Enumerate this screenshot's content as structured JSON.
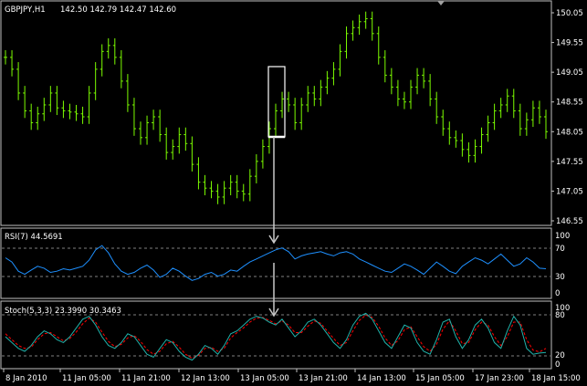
{
  "window": {
    "symbol_label": "GBPJPY,H1",
    "ohlc_label": "142.50 142.79 142.47 142.60"
  },
  "price_panel": {
    "y_ticks": [
      "150.05",
      "149.55",
      "149.05",
      "148.55",
      "148.05",
      "147.55",
      "147.05",
      "146.55"
    ]
  },
  "rsi_panel": {
    "label": "RSI(7) 44.5691",
    "y_ticks": [
      "100",
      "70",
      "30",
      "0"
    ]
  },
  "stoch_panel": {
    "label": "Stoch(5,3,3) 23.3990 30.3463",
    "y_ticks": [
      "100",
      "80",
      "20",
      "0"
    ]
  },
  "time_axis": {
    "labels": [
      "8 Jan 2010",
      "11 Jan 05:00",
      "11 Jan 21:00",
      "12 Jan 13:00",
      "13 Jan 05:00",
      "13 Jan 21:00",
      "14 Jan 13:00",
      "15 Jan 05:00",
      "17 Jan 23:00",
      "18 Jan 15:00"
    ]
  },
  "colors": {
    "background": "#000000",
    "candle": "#7CFC00",
    "grid_border": "#C0C0C0",
    "rsi_line": "#1E90FF",
    "stoch_main": "#20B2AA",
    "stoch_signal": "#FF0000",
    "level_line": "#808080",
    "annotation": "#FFFFFF"
  },
  "chart_data": {
    "type": "line",
    "price_closes": [
      149.3,
      149.1,
      148.7,
      148.4,
      148.2,
      148.35,
      148.5,
      148.7,
      148.45,
      148.4,
      148.38,
      148.35,
      148.3,
      148.7,
      149.1,
      149.4,
      149.5,
      149.3,
      148.9,
      148.5,
      148.1,
      147.95,
      148.2,
      148.3,
      148.0,
      147.7,
      147.8,
      148.0,
      147.85,
      147.5,
      147.2,
      147.1,
      147.05,
      146.95,
      147.1,
      147.2,
      147.05,
      147.0,
      147.3,
      147.55,
      147.8,
      148.1,
      148.4,
      148.6,
      148.5,
      148.2,
      148.5,
      148.7,
      148.6,
      148.8,
      148.95,
      149.1,
      149.4,
      149.7,
      149.8,
      149.9,
      149.95,
      149.7,
      149.3,
      149.0,
      148.8,
      148.6,
      148.55,
      148.8,
      149.0,
      148.9,
      148.6,
      148.3,
      148.1,
      147.95,
      147.9,
      147.75,
      147.65,
      147.8,
      148.0,
      148.2,
      148.4,
      148.5,
      148.65,
      148.4,
      148.1,
      148.25,
      148.45,
      148.3,
      148.05
    ],
    "rsi_values": [
      62,
      55,
      40,
      35,
      42,
      48,
      45,
      38,
      40,
      44,
      42,
      45,
      48,
      58,
      75,
      82,
      70,
      52,
      40,
      35,
      38,
      45,
      50,
      42,
      30,
      35,
      45,
      40,
      32,
      25,
      28,
      35,
      38,
      32,
      35,
      42,
      40,
      48,
      55,
      60,
      65,
      70,
      75,
      78,
      72,
      60,
      65,
      68,
      70,
      72,
      68,
      65,
      70,
      72,
      68,
      60,
      55,
      50,
      45,
      40,
      38,
      45,
      52,
      48,
      42,
      35,
      45,
      55,
      48,
      40,
      36,
      48,
      55,
      62,
      58,
      52,
      60,
      68,
      58,
      48,
      52,
      62,
      55,
      45,
      44
    ],
    "stoch_main": [
      50,
      40,
      30,
      25,
      35,
      50,
      60,
      55,
      45,
      40,
      50,
      65,
      80,
      85,
      70,
      50,
      35,
      30,
      40,
      55,
      50,
      35,
      20,
      15,
      30,
      45,
      40,
      25,
      15,
      10,
      20,
      35,
      30,
      20,
      35,
      55,
      60,
      70,
      80,
      85,
      82,
      75,
      70,
      80,
      65,
      50,
      60,
      75,
      80,
      70,
      55,
      40,
      30,
      45,
      70,
      85,
      90,
      80,
      60,
      40,
      30,
      50,
      70,
      65,
      40,
      25,
      20,
      45,
      75,
      80,
      50,
      30,
      45,
      70,
      80,
      65,
      40,
      30,
      60,
      85,
      70,
      30,
      20,
      22,
      23
    ],
    "stoch_signal": [
      55,
      45,
      35,
      30,
      32,
      45,
      55,
      57,
      50,
      43,
      47,
      58,
      72,
      82,
      75,
      58,
      42,
      33,
      37,
      48,
      52,
      42,
      28,
      20,
      25,
      38,
      42,
      32,
      20,
      13,
      18,
      30,
      32,
      25,
      30,
      48,
      57,
      65,
      75,
      82,
      83,
      78,
      72,
      77,
      70,
      57,
      57,
      68,
      77,
      73,
      60,
      47,
      35,
      40,
      60,
      78,
      87,
      83,
      68,
      48,
      35,
      43,
      62,
      67,
      50,
      33,
      25,
      37,
      63,
      77,
      60,
      38,
      40,
      62,
      75,
      70,
      50,
      35,
      50,
      75,
      75,
      45,
      27,
      24,
      30
    ],
    "price_ylim": [
      146.55,
      150.05
    ],
    "rsi_levels": [
      70,
      30
    ],
    "stoch_levels": [
      80,
      20
    ]
  }
}
